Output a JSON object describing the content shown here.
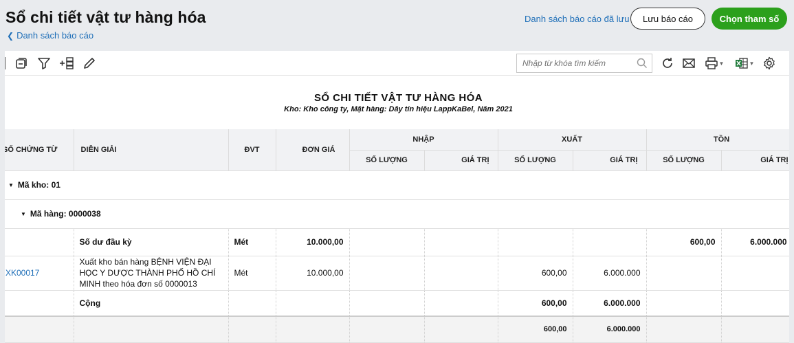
{
  "header": {
    "title": "Sổ chi tiết vật tư hàng hóa",
    "back_label": "Danh sách báo cáo",
    "saved_reports_label": "Danh sách báo cáo đã lưu",
    "save_button": "Lưu báo cáo",
    "choose_params_button": "Chọn tham số",
    "accent_color": "#2ca01c",
    "link_color": "#1f6fb8"
  },
  "toolbar": {
    "icons": [
      "collapse-icon",
      "filter-icon",
      "add-column-icon",
      "edit-icon"
    ],
    "search_placeholder": "Nhập từ khóa tìm kiếm",
    "right_icons": [
      "refresh-icon",
      "email-icon",
      "print-icon",
      "excel-icon",
      "settings-icon"
    ]
  },
  "report": {
    "title": "SỔ CHI TIẾT VẬT TƯ HÀNG HÓA",
    "subtitle": "Kho: Kho công ty, Mặt hàng: Dây tín hiệu LappKaBel, Năm 2021"
  },
  "table": {
    "headers": {
      "doc_no": "SỐ CHỨNG TỪ",
      "description": "DIỄN GIẢI",
      "unit": "ĐVT",
      "unit_price": "ĐƠN GIÁ",
      "import": "NHẬP",
      "export": "XUẤT",
      "balance": "TỒN",
      "qty": "SỐ LƯỢNG",
      "value": "GIÁ TRỊ"
    },
    "group1": "Mã kho: 01",
    "group2": "Mã hàng: 0000038",
    "opening": {
      "label": "Số dư đầu kỳ",
      "unit": "Mét",
      "price": "10.000,00",
      "bal_qty": "600,00",
      "bal_value": "6.000.000"
    },
    "row": {
      "doc_no": "XK00017",
      "description": "Xuất kho bán hàng BỆNH VIỆN ĐẠI HỌC Y DƯỢC THÀNH PHỐ HỒ CHÍ MINH theo hóa đơn số 0000013",
      "unit": "Mét",
      "price": "10.000,00",
      "exp_qty": "600,00",
      "exp_value": "6.000.000"
    },
    "subtotal": {
      "label": "Cộng",
      "exp_qty": "600,00",
      "exp_value": "6.000.000"
    },
    "grand_total": {
      "exp_qty": "600,00",
      "exp_value": "6.000.000"
    }
  }
}
